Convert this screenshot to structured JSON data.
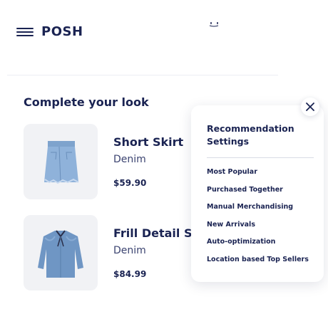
{
  "header": {
    "logo": "POSH",
    "menu_icon": "hamburger-menu-icon"
  },
  "section": {
    "title": "Complete your look"
  },
  "products": [
    {
      "name": "Short Skirt",
      "material": "Denim",
      "price": "$59.90",
      "image": "denim-skirt"
    },
    {
      "name": "Frill Detail Shi",
      "material": "Denim",
      "price": "$84.99",
      "image": "denim-shirt"
    }
  ],
  "recommendation_settings": {
    "title": "Recommendation Settings",
    "options": [
      "Most Popular",
      "Purchased Together",
      "Manual Merchandising",
      "New Arrivals",
      "Auto-optimization",
      "Location based Top Sellers"
    ],
    "close_icon": "close-icon"
  },
  "colors": {
    "text_primary": "#1a2352",
    "card_background": "#f1f2f5",
    "denim": "#6f96c4"
  }
}
